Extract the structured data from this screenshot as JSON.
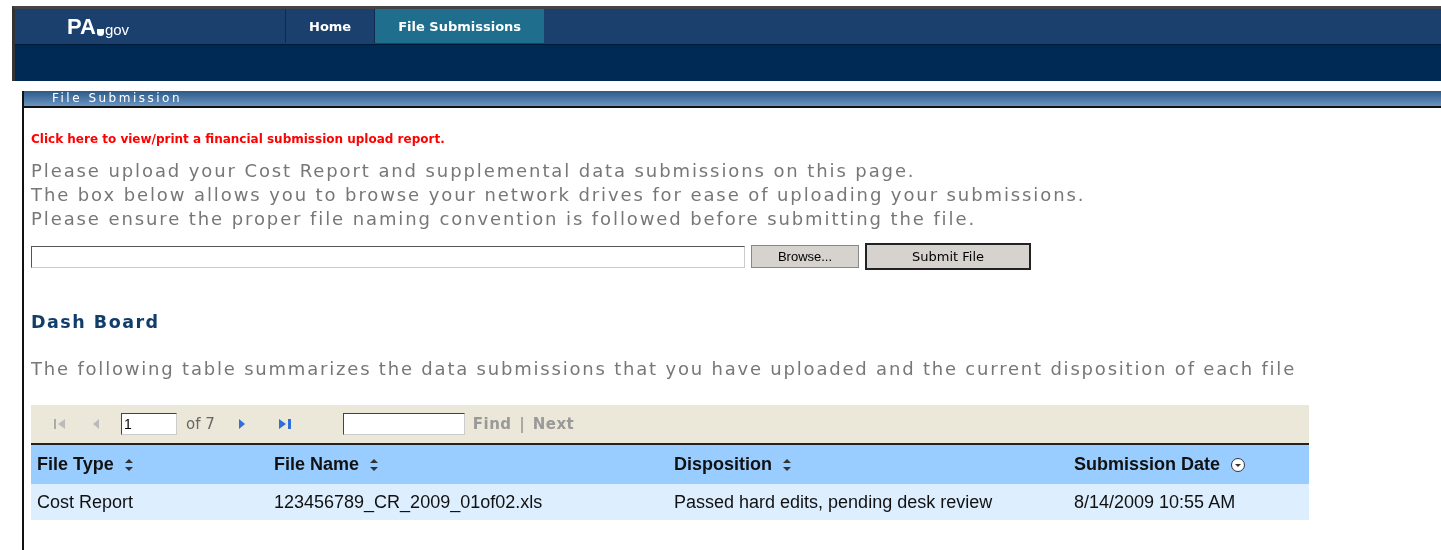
{
  "header": {
    "logo": {
      "main": "PA",
      "suffix": "gov"
    },
    "tabs": [
      {
        "label": "Home",
        "selected": false
      },
      {
        "label": "File Submissions",
        "selected": true
      }
    ]
  },
  "panel": {
    "title": "File Submission",
    "report_link": "Click here to view/print a financial submission upload report.",
    "instructions": [
      "Please upload your Cost Report and supplemental data submissions on this page.",
      "The box below allows you to browse your network drives for ease of uploading your submissions.",
      "Please ensure the proper file naming convention is followed before submitting the file."
    ],
    "upload": {
      "browse_button": "Browse...",
      "submit_button": "Submit File"
    },
    "dashboard": {
      "heading": "Dash Board",
      "description": "The following table summarizes the data submissions that you have uploaded and the current disposition of each file",
      "pager": {
        "page": "1",
        "of_pages": "of 7",
        "find_button": "Find",
        "separator": "|",
        "next_button": "Next"
      },
      "table": {
        "columns": [
          {
            "label": "File Type",
            "sorted": false
          },
          {
            "label": "File Name",
            "sorted": false
          },
          {
            "label": "Disposition",
            "sorted": false
          },
          {
            "label": "Submission Date",
            "sorted": true
          }
        ],
        "rows": [
          [
            "Cost Report",
            "123456789_CR_2009_01of02.xls",
            "Passed hard edits, pending desk review",
            "8/14/2009 10:55 AM"
          ]
        ]
      }
    }
  }
}
